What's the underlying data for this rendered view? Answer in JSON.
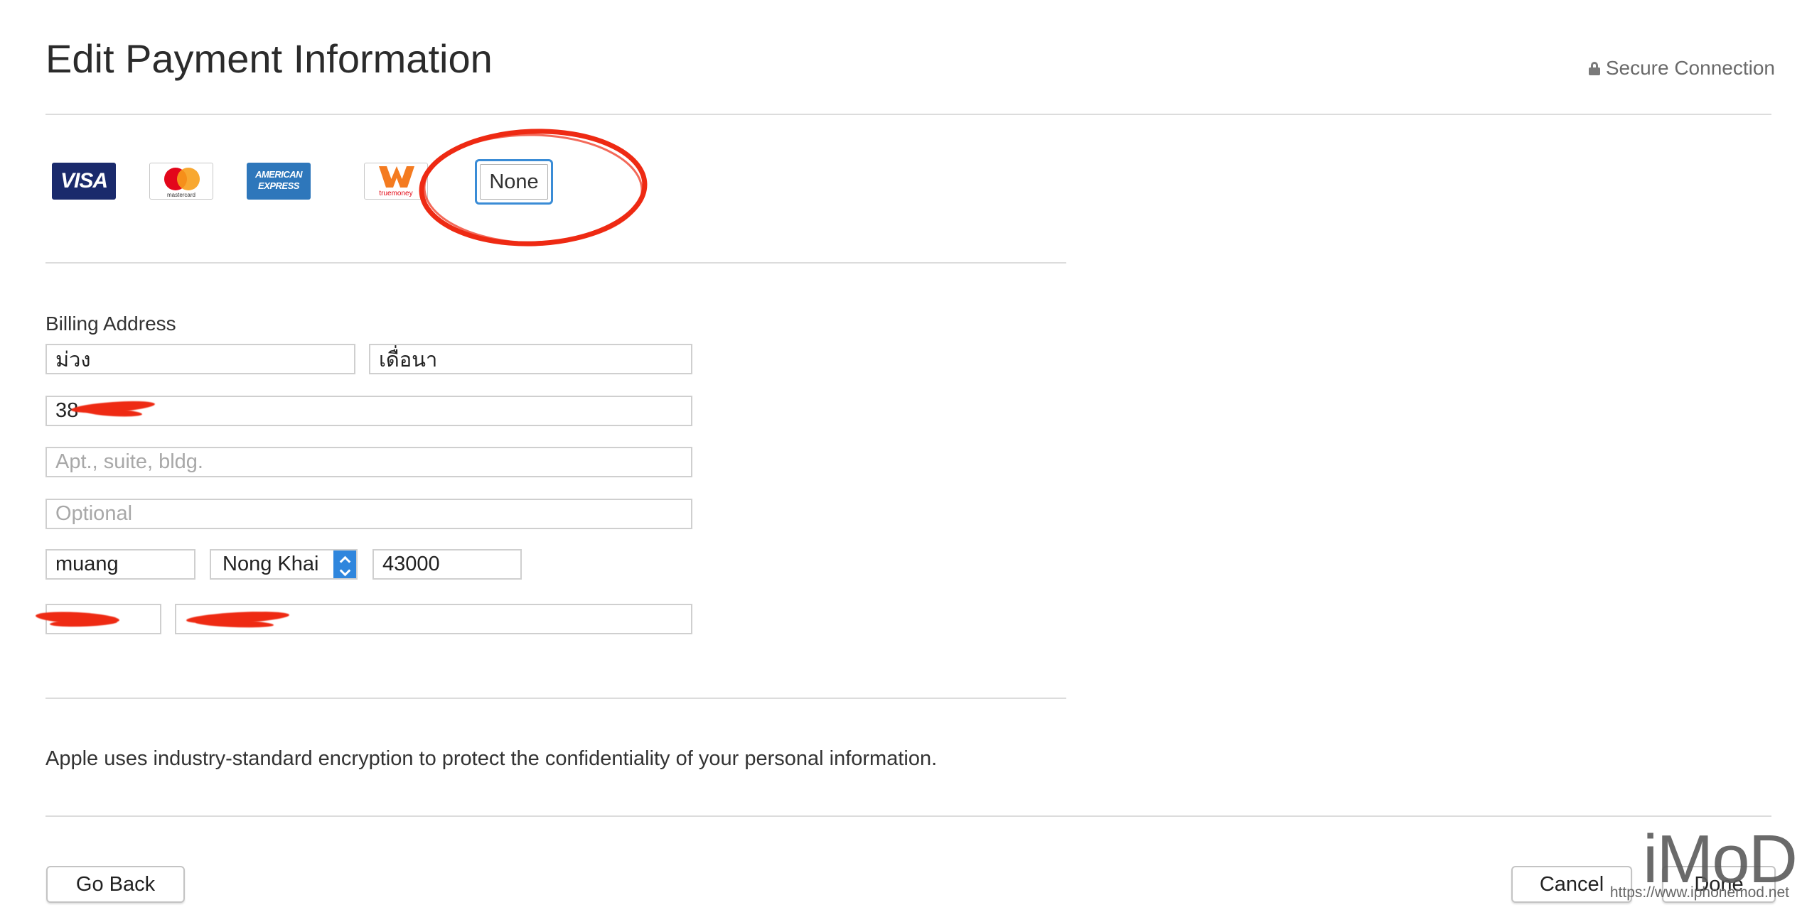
{
  "page": {
    "title": "Edit Payment Information",
    "secure_label": "Secure Connection"
  },
  "payment_methods": {
    "visa": "VISA",
    "mastercard": "mastercard",
    "amex_line1": "AMERICAN",
    "amex_line2": "EXPRESS",
    "truemoney": "truemoney",
    "none_label": "None",
    "selected": "None"
  },
  "billing": {
    "heading": "Billing Address",
    "first_name": "ม่วง",
    "last_name": "เดื่อนา",
    "street_value": "38",
    "street2_placeholder": "Apt., suite, bldg.",
    "street3_placeholder": "Optional",
    "city": "muang",
    "province": "Nong Khai",
    "postal_code": "43000",
    "phone_area": "",
    "phone_number": ""
  },
  "note": "Apple uses industry-standard encryption to protect the confidentiality of your personal information.",
  "footer": {
    "go_back": "Go Back",
    "cancel": "Cancel",
    "done": "Done"
  },
  "watermark": {
    "logo": "iMoD",
    "url": "https://www.iphonemod.net"
  },
  "colors": {
    "selection_border": "#3a8cd6",
    "stepper": "#2f86dd",
    "annotation": "#ee2a13"
  }
}
